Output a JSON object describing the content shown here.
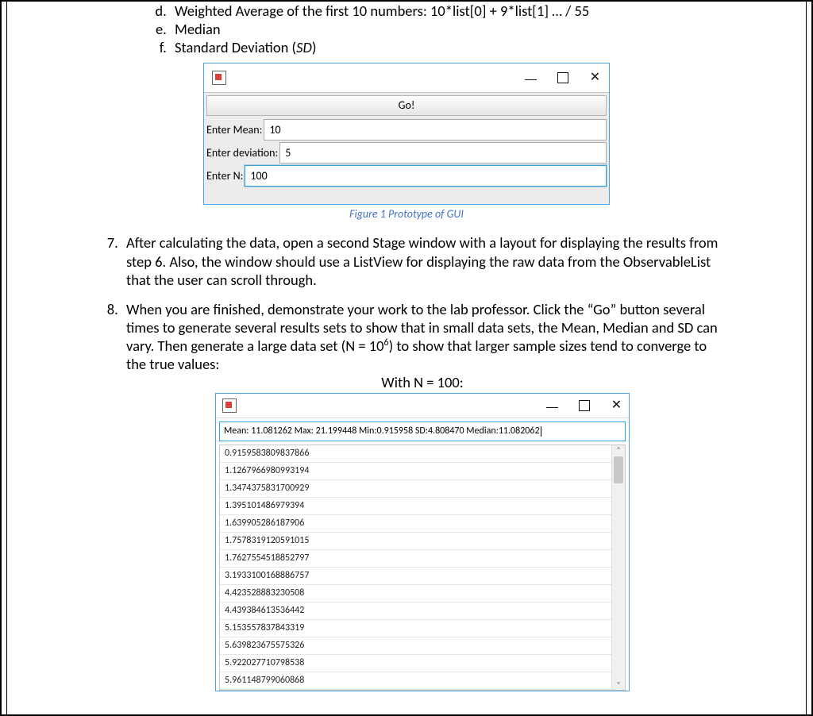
{
  "list_items": {
    "d": "Weighted Average of the first 10 numbers: 10*list[0] + 9*list[1] … / 55",
    "e": "Median",
    "f_pre": "Standard Deviation (",
    "f_sd": "SD",
    "f_post": ")"
  },
  "fig1": {
    "go_label": "Go!",
    "mean_label": "Enter Mean:",
    "mean_value": "10",
    "dev_label": "Enter deviation:",
    "dev_value": "5",
    "n_label": "Enter N:",
    "n_value": "100",
    "caption": "Figure 1 Prototype of GUI"
  },
  "step7": "After calculating the data, open a second Stage window with a layout for displaying the results from step 6. Also, the window should use a ListView for displaying the raw data from the ObservableList that the user can scroll through.",
  "step8_pre": "When you are finished, demonstrate your work to the lab professor. Click the “Go” button several times to generate several results sets to show that in small data sets, the Mean, Median and SD can vary. Then generate a large data set (N = 10",
  "step8_sup": "6",
  "step8_post": ") to show that larger sample sizes tend to converge to the true values:",
  "with_n": "With N = 100:",
  "fig2": {
    "summary": "Mean: 11.081262  Max: 21.199448  Min:0.915958  SD:4.808470  Median:11.082062",
    "data": [
      "0.9159583809837866",
      "1.1267966980993194",
      "1.3474375831700929",
      "1.395101486979394",
      "1.639905286187906",
      "1.7578319120591015",
      "1.7627554518852797",
      "3.1933100168886757",
      "4.423528883230508",
      "4.439384613536442",
      "5.153557837843319",
      "5.639823675575326",
      "5.922027710798538",
      "5.961148799060868"
    ]
  }
}
